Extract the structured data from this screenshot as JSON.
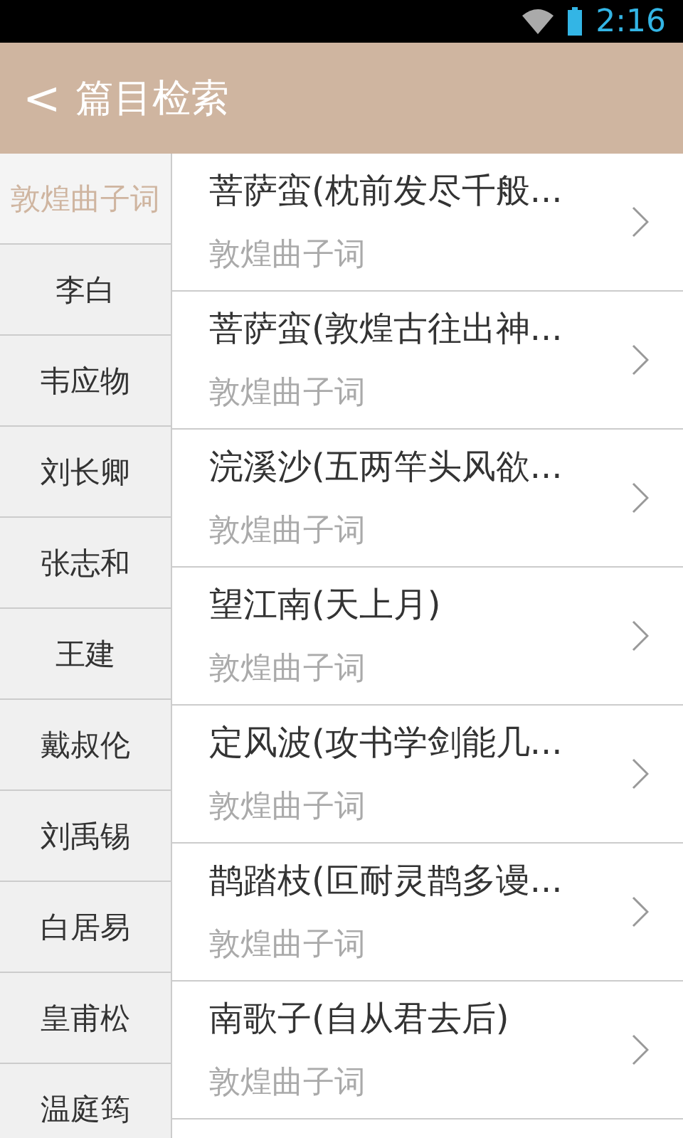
{
  "status_bar": {
    "time": "2:16"
  },
  "header": {
    "back": "<",
    "title": "篇目检索"
  },
  "sidebar": {
    "items": [
      {
        "label": "敦煌曲子词",
        "selected": true
      },
      {
        "label": "李白",
        "selected": false
      },
      {
        "label": "韦应物",
        "selected": false
      },
      {
        "label": "刘长卿",
        "selected": false
      },
      {
        "label": "张志和",
        "selected": false
      },
      {
        "label": "王建",
        "selected": false
      },
      {
        "label": "戴叔伦",
        "selected": false
      },
      {
        "label": "刘禹锡",
        "selected": false
      },
      {
        "label": "白居易",
        "selected": false
      },
      {
        "label": "皇甫松",
        "selected": false
      },
      {
        "label": "温庭筠",
        "selected": false
      }
    ]
  },
  "list": {
    "rows": [
      {
        "title": "菩萨蛮(枕前发尽千般...",
        "subtitle": "敦煌曲子词"
      },
      {
        "title": "菩萨蛮(敦煌古往出神...",
        "subtitle": "敦煌曲子词"
      },
      {
        "title": "浣溪沙(五两竿头风欲...",
        "subtitle": "敦煌曲子词"
      },
      {
        "title": "望江南(天上月)",
        "subtitle": "敦煌曲子词"
      },
      {
        "title": "定风波(攻书学剑能几...",
        "subtitle": "敦煌曲子词"
      },
      {
        "title": "鹊踏枝(叵耐灵鹊多谩...",
        "subtitle": "敦煌曲子词"
      },
      {
        "title": "南歌子(自从君去后)",
        "subtitle": "敦煌曲子词"
      }
    ]
  }
}
